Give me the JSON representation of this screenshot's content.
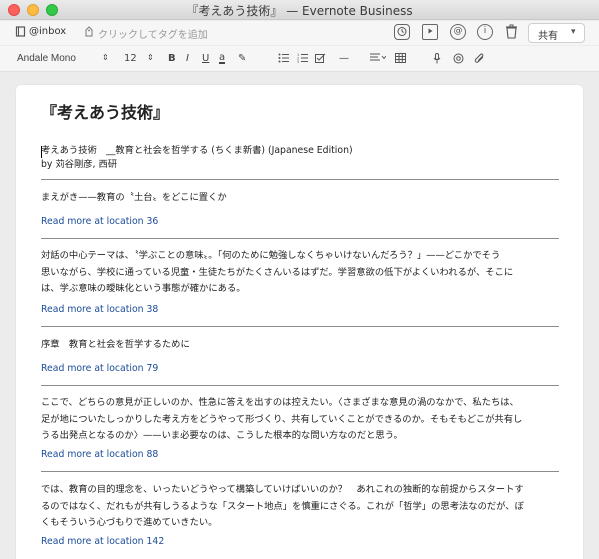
{
  "window": {
    "title": "『考えあう技術』 — Evernote Business"
  },
  "notebar": {
    "notebook_icon": "notebook-icon",
    "notebook": "@inbox",
    "tag_placeholder": "クリックしてタグを追加",
    "right_icons": [
      "reminder-icon",
      "presentation-icon",
      "at-icon",
      "info-icon",
      "trash-icon"
    ],
    "share_label": "共有"
  },
  "toolbar": {
    "font": "Andale Mono",
    "size": "12",
    "bold": "B",
    "italic": "I",
    "underline": "U",
    "highlight": "a"
  },
  "note": {
    "title": "『考えあう技術』",
    "book_line": "考えあう技術　__教育と社会を哲学する (ちくま新書) (Japanese Edition)",
    "author_line": "by 苅谷剛彦, 西研",
    "highlights": [
      {
        "lines": [
          "まえがき——教育の〝土台〟をどこに置くか"
        ],
        "link": "Read more at location 36"
      },
      {
        "lines": [
          "対話の中心テーマは、〝学ぶことの意味〟。「何のために勉強しなくちゃいけないんだろう？」——どこかでそう",
          "思いながら、学校に通っている児童・生徒たちがたくさんいるはずだ。学習意欲の低下がよくいわれるが、そこに",
          "は、学ぶ意味の曖昧化という事態が確かにある。"
        ],
        "link": "Read more at location 38"
      },
      {
        "lines": [
          "序章　教育と社会を哲学するために"
        ],
        "link": "Read more at location 79"
      },
      {
        "lines": [
          "ここで、どちらの意見が正しいのか、性急に答えを出すのは控えたい。〈さまざまな意見の渦のなかで、私たちは、",
          "足が地についたしっかりした考え方をどうやって形づくり、共有していくことができるのか。そもそもどこが共有し",
          "うる出発点となるのか〉——いま必要なのは、こうした根本的な問い方なのだと思う。"
        ],
        "link": "Read more at location 88"
      },
      {
        "lines": [
          "では、教育の目的理念を、いったいどうやって構築していけばいいのか？　あれこれの独断的な前提からスタートす",
          "るのではなく、だれもが共有しうるような「スタート地点」を慎重にさぐる。これが「哲学」の思考法なのだが、ぼ",
          "くもそういう心づもりで進めていきたい。"
        ],
        "link": "Read more at location 142"
      }
    ]
  }
}
